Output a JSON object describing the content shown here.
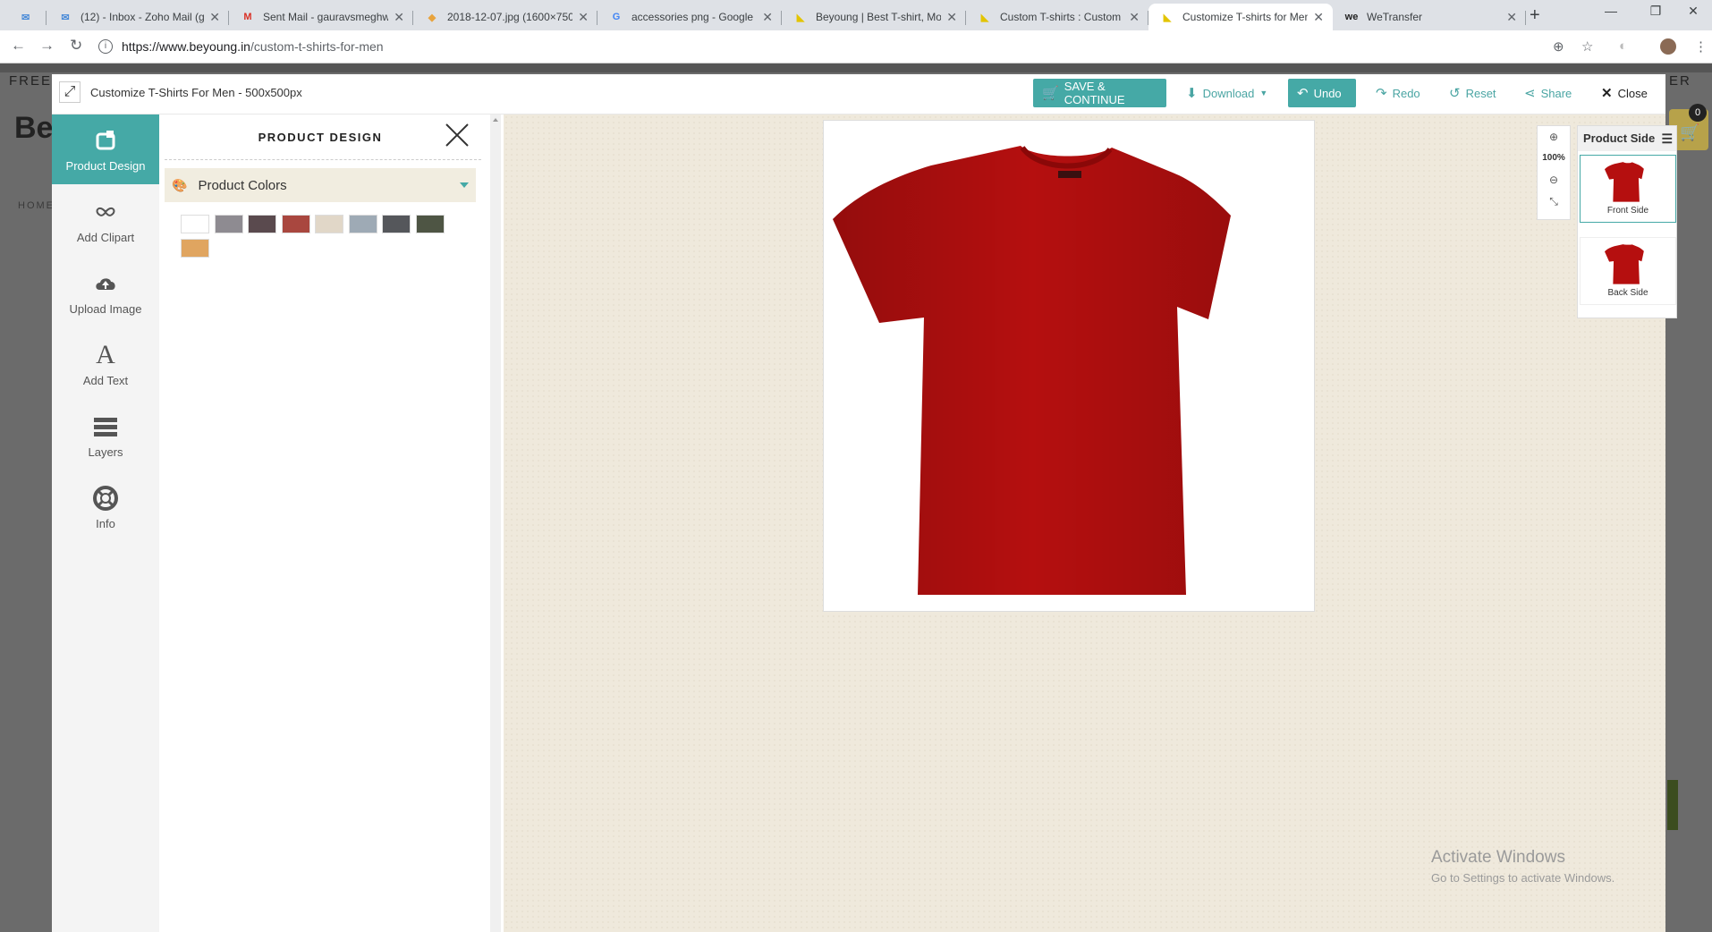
{
  "browser": {
    "tabs": [
      {
        "title": "(12) - Inbox - Zoho Mail (g",
        "icon": "zoho-mail-icon",
        "glyph": "✉",
        "icon_color": "#4a8bd8"
      },
      {
        "title": "Sent Mail - gauravsmeghw",
        "icon": "gmail-icon",
        "glyph": "M",
        "icon_color": "#d93025"
      },
      {
        "title": "2018-12-07.jpg (1600×750",
        "icon": "image-file-icon",
        "glyph": "◆",
        "icon_color": "#e8a33d"
      },
      {
        "title": "accessories png - Google S",
        "icon": "google-icon",
        "glyph": "G",
        "icon_color": "#4285f4"
      },
      {
        "title": "Beyoung | Best T-shirt, Mo",
        "icon": "beyoung-icon",
        "glyph": "◣",
        "icon_color": "#e3c400"
      },
      {
        "title": "Custom T-shirts : Custom T",
        "icon": "beyoung-icon",
        "glyph": "◣",
        "icon_color": "#e3c400"
      },
      {
        "title": "Customize T-shirts for Men",
        "icon": "beyoung-icon",
        "glyph": "◣",
        "icon_color": "#e3c400"
      },
      {
        "title": "WeTransfer",
        "icon": "wetransfer-icon",
        "glyph": "we",
        "icon_color": "#222222"
      }
    ],
    "new_tab": "+",
    "url_host": "https://www.beyoung.in",
    "url_path": "/custom-t-shirts-for-men"
  },
  "site_bg": {
    "free_text": "FREE S",
    "right_text": "ER",
    "logo_text": "Be",
    "home_text": "HOME",
    "cart_count": "0"
  },
  "header": {
    "title": "Customize T-Shirts For Men - 500x500px",
    "save": "SAVE & CONTINUE",
    "download": "Download",
    "undo": "Undo",
    "redo": "Redo",
    "reset": "Reset",
    "share": "Share",
    "close": "Close"
  },
  "rail": [
    {
      "label": "Product Design",
      "icon": "product-design-icon"
    },
    {
      "label": "Add Clipart",
      "icon": "clipart-icon"
    },
    {
      "label": "Upload Image",
      "icon": "upload-cloud-icon"
    },
    {
      "label": "Add Text",
      "icon": "text-icon"
    },
    {
      "label": "Layers",
      "icon": "layers-icon"
    },
    {
      "label": "Info",
      "icon": "lifebuoy-icon"
    }
  ],
  "panel": {
    "title": "PRODUCT DESIGN",
    "section": "Product Colors",
    "colors": [
      "#ffffff",
      "#8e8b91",
      "#5a4a4e",
      "#a9473f",
      "#e1d7c8",
      "#9eaab5",
      "#55575b",
      "#4e5544",
      "#e0a560"
    ]
  },
  "canvas": {
    "zoom": "100%",
    "product_color": "#b50f0f",
    "side_title": "Product Side",
    "sides": [
      "Front Side",
      "Back Side"
    ]
  },
  "watermark": {
    "line1": "Activate Windows",
    "line2": "Go to Settings to activate Windows."
  }
}
